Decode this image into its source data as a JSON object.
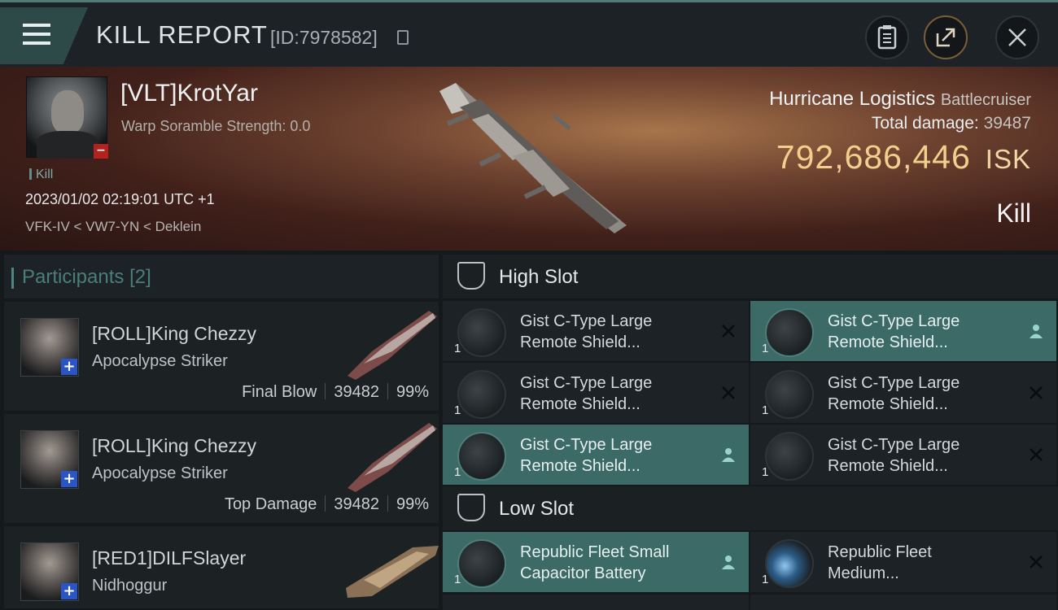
{
  "header": {
    "title": "KILL REPORT",
    "id_label": "[ID:7978582]"
  },
  "victim": {
    "name": "[VLT]KrotYar",
    "scramble": "Warp Soramble Strength: 0.0",
    "kill_tag": "Kill",
    "datetime": "2023/01/02 02:19:01 UTC +1",
    "location": "VFK-IV < VW7-YN < Deklein",
    "ship": "Hurricane Logistics",
    "ship_class": "Battlecruiser",
    "total_damage_label": "Total damage:",
    "total_damage": "39487",
    "isk_value": "792,686,446",
    "isk_unit": "ISK",
    "result": "Kill"
  },
  "participants": {
    "title": "Participants",
    "count": "[2]",
    "rows": [
      {
        "name": "[ROLL]King Chezzy",
        "ship": "Apocalypse Striker",
        "tag": "Final Blow",
        "damage": "39482",
        "pct": "99%"
      },
      {
        "name": "[ROLL]King Chezzy",
        "ship": "Apocalypse Striker",
        "tag": "Top Damage",
        "damage": "39482",
        "pct": "99%"
      },
      {
        "name": "[RED1]DILFSlayer",
        "ship": "Nidhoggur",
        "tag": "",
        "damage": "",
        "pct": ""
      }
    ]
  },
  "high_slot": {
    "title": "High Slot",
    "items": [
      {
        "l1": "Gist C-Type Large",
        "l2": "Remote Shield...",
        "qty": "1",
        "status": "destroyed"
      },
      {
        "l1": "Gist C-Type Large",
        "l2": "Remote Shield...",
        "qty": "1",
        "status": "dropped"
      },
      {
        "l1": "Gist C-Type Large",
        "l2": "Remote Shield...",
        "qty": "1",
        "status": "destroyed"
      },
      {
        "l1": "Gist C-Type Large",
        "l2": "Remote Shield...",
        "qty": "1",
        "status": "destroyed"
      },
      {
        "l1": "Gist C-Type Large",
        "l2": "Remote Shield...",
        "qty": "1",
        "status": "dropped"
      },
      {
        "l1": "Gist C-Type Large",
        "l2": "Remote Shield...",
        "qty": "1",
        "status": "destroyed"
      }
    ]
  },
  "low_slot": {
    "title": "Low Slot",
    "items": [
      {
        "l1": "Republic Fleet Small",
        "l2": "Capacitor Battery",
        "qty": "1",
        "status": "dropped"
      },
      {
        "l1": "Republic Fleet",
        "l2": "Medium...",
        "qty": "1",
        "status": "destroyed"
      }
    ]
  },
  "colors": {
    "accent": "#4f7a76",
    "isk": "#f1cf8c",
    "dropped_bg": "#3c6a66",
    "badge_blue": "#2a55c8",
    "badge_red": "#b3221e"
  }
}
